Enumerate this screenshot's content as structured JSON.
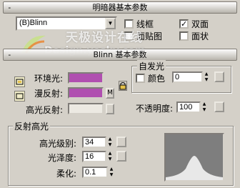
{
  "basic_params": {
    "header_toggle": "-",
    "header_title": "明暗器基本参数",
    "shader_value": "(B)Blinn",
    "wire_label": "线框",
    "wire_checked": false,
    "two_sided_label": "双面",
    "two_sided_checked": true,
    "face_map_label": "面贴图",
    "face_map_checked": false,
    "faceted_label": "面状",
    "faceted_checked": false
  },
  "watermark": {
    "line1": "天极设计在线",
    "line2": "Design.yesky.com"
  },
  "blinn_params": {
    "header_toggle": "-",
    "header_title": "Blinn 基本参数",
    "ambient_label": "环境光:",
    "ambient_color": "#b04fb0",
    "diffuse_label": "漫反射:",
    "diffuse_color": "#b04fb0",
    "map_button_label": "M",
    "specular_label": "高光反射:",
    "specular_color": "#ece9e2",
    "self_illum_title": "自发光",
    "color_label": "颜色",
    "color_checked": false,
    "self_illum_value": "0",
    "opacity_label": "不透明度:",
    "opacity_value": "100"
  },
  "specular_highlights": {
    "title": "反射高光",
    "level_label": "高光级别:",
    "level_value": "34",
    "gloss_label": "光泽度:",
    "gloss_value": "16",
    "soften_label": "柔化:",
    "soften_value": "0.1"
  },
  "colors": {
    "panel_bg": "#d4d0c8",
    "swatch_purple": "#b04fb0",
    "graph_bg": "#7e7e7e",
    "graph_curve": "#e8e8e8"
  }
}
